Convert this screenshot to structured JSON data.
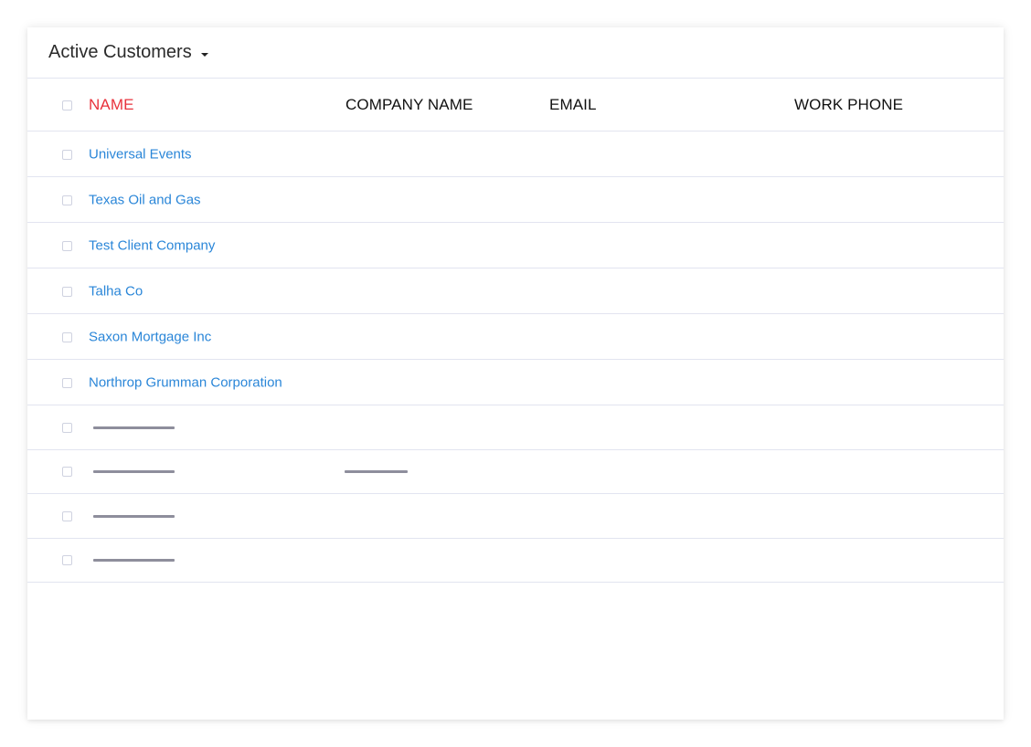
{
  "view": {
    "title": "Active Customers"
  },
  "table": {
    "columns": {
      "name": "NAME",
      "company_name": "COMPANY NAME",
      "email": "EMAIL",
      "work_phone": "WORK PHONE"
    },
    "rows": [
      {
        "name": "Universal Events"
      },
      {
        "name": "Texas Oil and Gas"
      },
      {
        "name": "Test Client Company"
      },
      {
        "name": "Talha Co"
      },
      {
        "name": "Saxon Mortgage Inc"
      },
      {
        "name": "Northrop Grumman Corporation"
      }
    ],
    "loading_rows": 4
  },
  "colors": {
    "accent_sort": "#e8323c",
    "link": "#2a86d8",
    "divider": "#e2e4f0",
    "skeleton": "#8e8e9c"
  }
}
